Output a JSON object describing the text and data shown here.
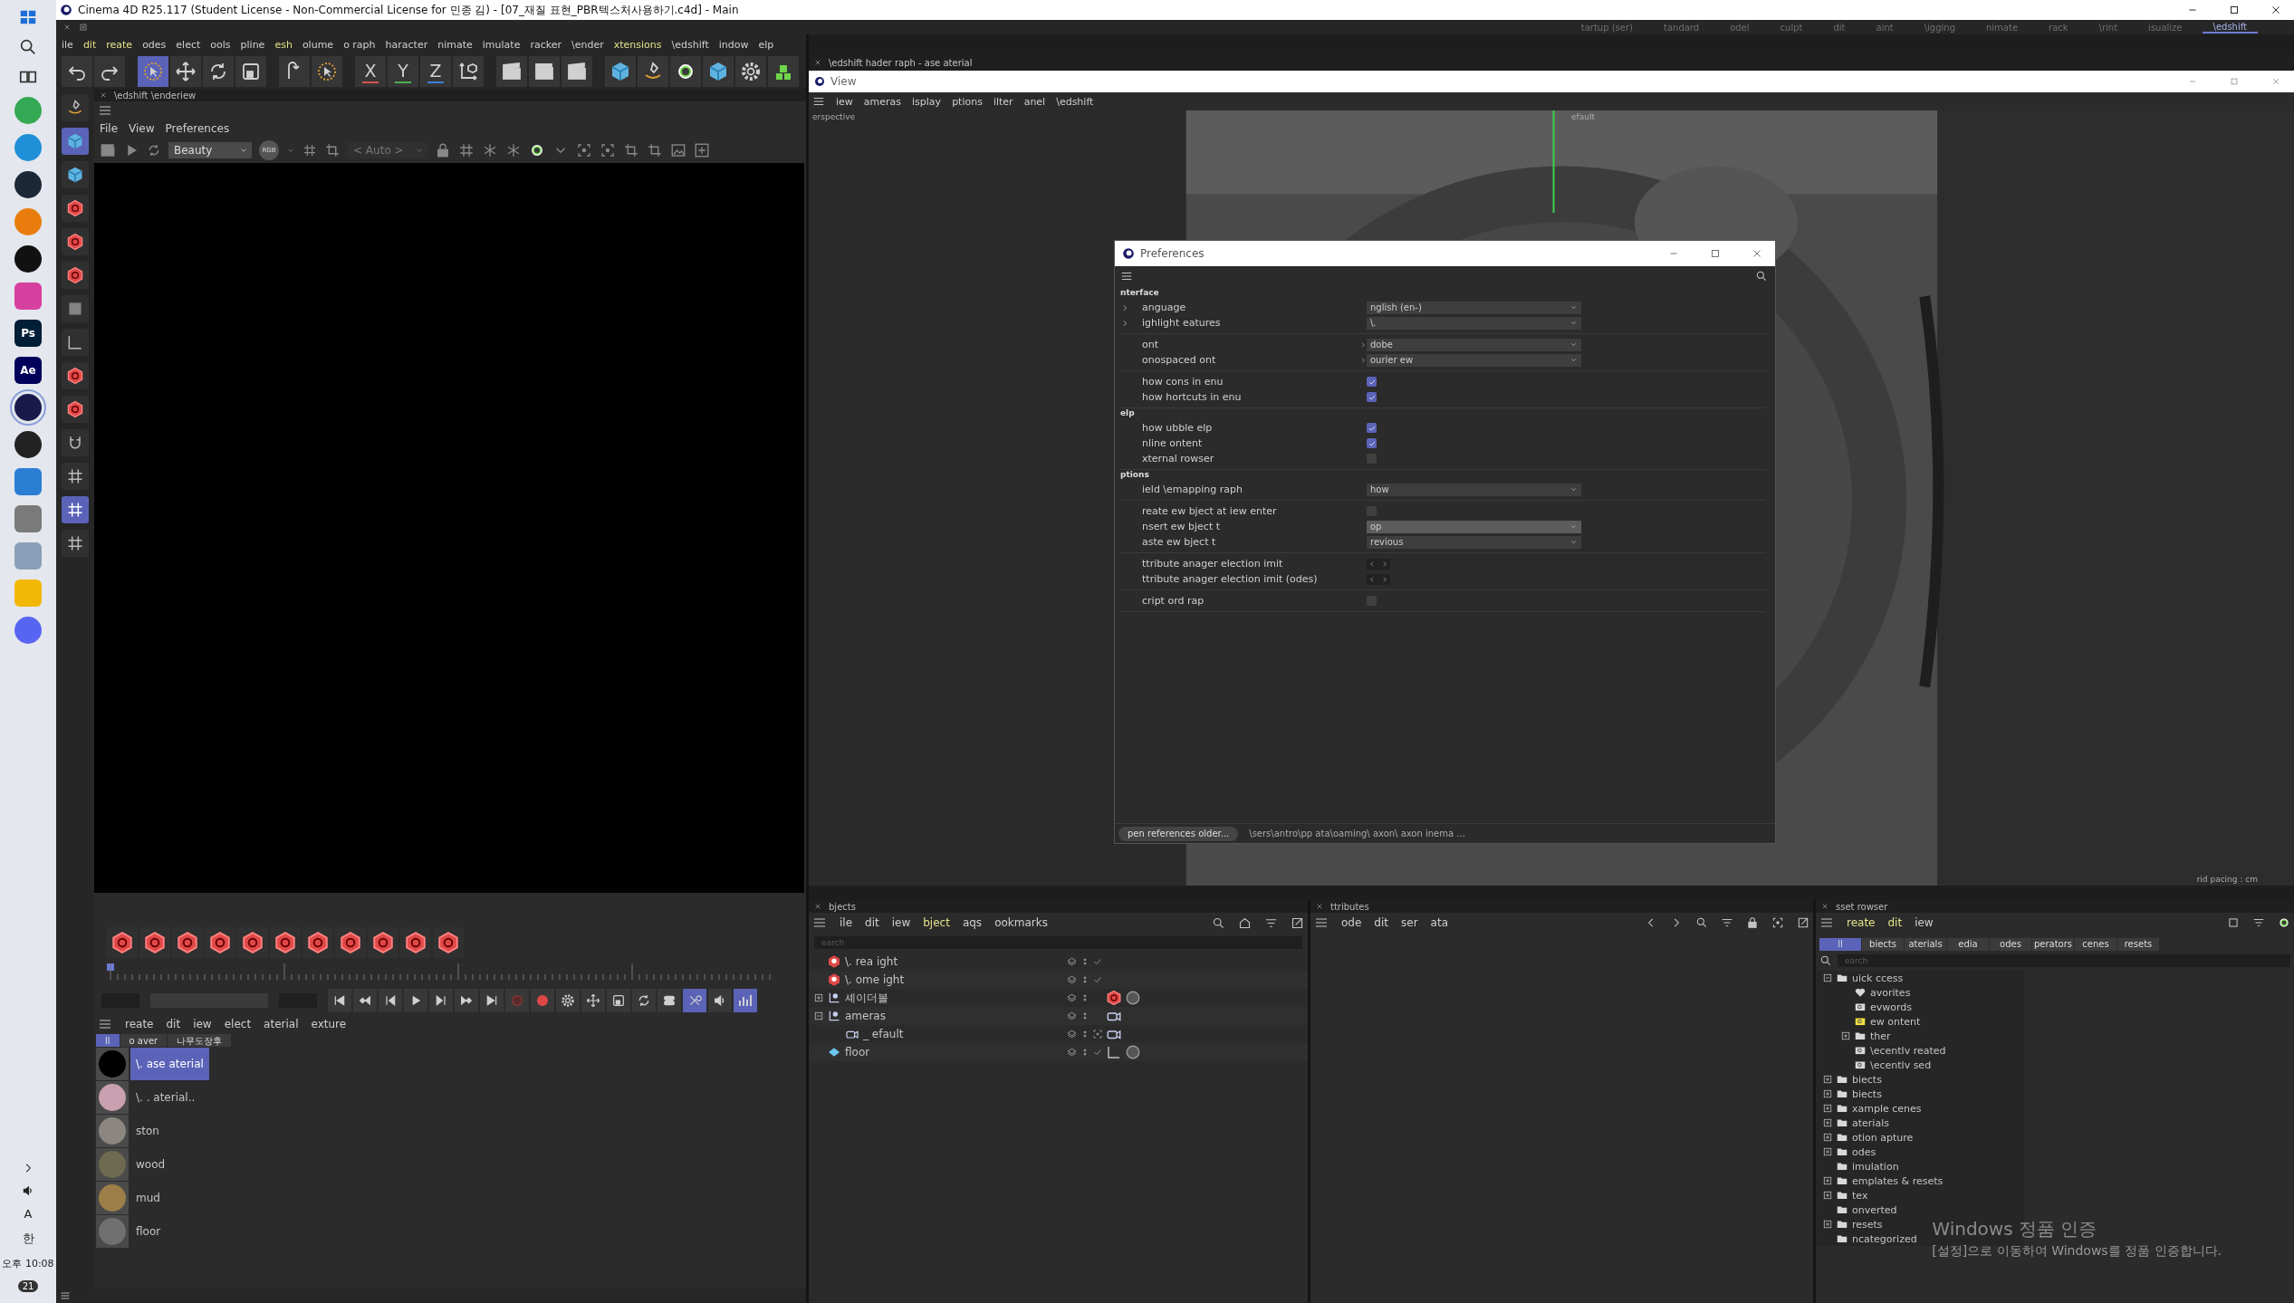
{
  "titlebar": {
    "title": "Cinema 4D R25.117 (Student License - Non-Commercial License for 민종 김) - [07_재질 표현_PBR텍스처사용하기.c4d] - Main"
  },
  "taskbar": {
    "apps": [
      {
        "kind": "circle",
        "color": "#34a853",
        "selected": false
      },
      {
        "kind": "circle",
        "color": "#1f8fd8",
        "selected": false
      },
      {
        "kind": "circle",
        "color": "#1b2838",
        "selected": false
      },
      {
        "kind": "circle",
        "color": "#e87d0d",
        "selected": false
      },
      {
        "kind": "circle",
        "color": "#111111",
        "selected": false
      },
      {
        "kind": "tile",
        "color": "#d6409f",
        "selected": false
      },
      {
        "kind": "tile",
        "color": "#001e36",
        "label": "Ps",
        "selected": false
      },
      {
        "kind": "tile",
        "color": "#00005b",
        "label": "Ae",
        "selected": false
      },
      {
        "kind": "circle",
        "color": "#1a1a4a",
        "selected": true
      },
      {
        "kind": "circle",
        "color": "#222222",
        "selected": false
      },
      {
        "kind": "tile",
        "color": "#2a7fd4",
        "selected": false
      },
      {
        "kind": "tile",
        "color": "#7a7a7a",
        "selected": false
      },
      {
        "kind": "tile",
        "color": "#8aa0b8",
        "selected": false
      },
      {
        "kind": "tile",
        "color": "#f2b705",
        "selected": false
      },
      {
        "kind": "circle",
        "color": "#5865f2",
        "selected": false
      }
    ],
    "input": [
      "A",
      "한"
    ],
    "clock": "오후 10:08",
    "badge": "21"
  },
  "layouts": [
    {
      "label": "tartup (ser)",
      "selected": false
    },
    {
      "label": "tandard",
      "selected": false
    },
    {
      "label": "odel",
      "selected": false
    },
    {
      "label": "culpt",
      "selected": false
    },
    {
      "label": "dit",
      "selected": false
    },
    {
      "label": "aint",
      "selected": false
    },
    {
      "label": "\\igging",
      "selected": false
    },
    {
      "label": "nimate",
      "selected": false
    },
    {
      "label": "rack",
      "selected": false
    },
    {
      "label": "\\rint",
      "selected": false
    },
    {
      "label": "isualize",
      "selected": false
    },
    {
      "label": "\\edshift",
      "selected": true
    }
  ],
  "menubar": [
    {
      "label": "ile",
      "highlight": false
    },
    {
      "label": "dit",
      "highlight": true
    },
    {
      "label": "reate",
      "highlight": true
    },
    {
      "label": "odes",
      "highlight": false
    },
    {
      "label": "elect",
      "highlight": false
    },
    {
      "label": "ools",
      "highlight": false
    },
    {
      "label": "pline",
      "highlight": false
    },
    {
      "label": "esh",
      "highlight": true
    },
    {
      "label": "olume",
      "highlight": false
    },
    {
      "label": "o raph",
      "highlight": false
    },
    {
      "label": "haracter",
      "highlight": false
    },
    {
      "label": "nimate",
      "highlight": false
    },
    {
      "label": "imulate",
      "highlight": false
    },
    {
      "label": "racker",
      "highlight": false
    },
    {
      "label": "\\ender",
      "highlight": false
    },
    {
      "label": "xtensions",
      "highlight": true
    },
    {
      "label": "\\edshift",
      "highlight": false
    },
    {
      "label": "indow",
      "highlight": false
    },
    {
      "label": "elp",
      "highlight": false
    }
  ],
  "toolbar": [
    {
      "kind": "icon",
      "selected": false
    },
    {
      "kind": "icon",
      "selected": false
    },
    {
      "kind": "gap"
    },
    {
      "kind": "icon",
      "selected": true
    },
    {
      "kind": "icon",
      "selected": false
    },
    {
      "kind": "icon",
      "selected": false
    },
    {
      "kind": "icon",
      "selected": false
    },
    {
      "kind": "gap"
    },
    {
      "kind": "icon",
      "selected": false
    },
    {
      "kind": "icon",
      "selected": false
    },
    {
      "kind": "gap"
    },
    {
      "kind": "axis",
      "label": "X",
      "color": "#d9534f"
    },
    {
      "kind": "axis",
      "label": "Y",
      "color": "#4caf50"
    },
    {
      "kind": "axis",
      "label": "Z",
      "color": "#3f7fd8"
    },
    {
      "kind": "icon",
      "selected": false
    },
    {
      "kind": "gap"
    },
    {
      "kind": "icon",
      "selected": false
    },
    {
      "kind": "icon",
      "selected": false
    },
    {
      "kind": "icon",
      "selected": false
    },
    {
      "kind": "gap"
    },
    {
      "kind": "icon",
      "selected": false
    },
    {
      "kind": "icon",
      "selected": false
    },
    {
      "kind": "icon",
      "selected": false
    },
    {
      "kind": "icon",
      "selected": false
    },
    {
      "kind": "icon",
      "selected": false
    },
    {
      "kind": "icon",
      "selected": false
    }
  ],
  "tools": [
    {
      "selected": false
    },
    {
      "selected": true
    },
    {
      "selected": false
    },
    {
      "selected": false
    },
    {
      "selected": false
    },
    {
      "selected": false
    },
    {
      "selected": false
    },
    {
      "selected": false
    },
    {
      "selected": false
    },
    {
      "selected": false
    },
    {
      "selected": false
    },
    {
      "selected": false
    },
    {
      "selected": true
    },
    {
      "selected": false
    }
  ],
  "renderview": {
    "tab": "\\edshift \\enderiew",
    "menu": [
      "File",
      "View",
      "Preferences"
    ],
    "aov": "Beauty",
    "channel": "RGB",
    "zoom": "< Auto >"
  },
  "playback": [
    {
      "selected": false
    },
    {
      "selected": false
    },
    {
      "selected": false
    },
    {
      "selected": false
    },
    {
      "selected": false
    },
    {
      "selected": false
    },
    {
      "selected": false
    },
    {
      "selected": false
    },
    {
      "selected": false
    },
    {
      "selected": false
    },
    {
      "selected": false
    },
    {
      "selected": false
    },
    {
      "selected": false
    },
    {
      "selected": false
    },
    {
      "selected": true
    },
    {
      "selected": false
    },
    {
      "selected": true
    }
  ],
  "materials": {
    "menu": [
      "reate",
      "dit",
      "iew",
      "elect",
      "aterial",
      "exture"
    ],
    "tabs": [
      {
        "label": "ll",
        "selected": true
      },
      {
        "label": "o  aver",
        "selected": false
      },
      {
        "label": "나무도장후",
        "selected": false
      }
    ],
    "items": [
      {
        "name": "\\. ase  aterial",
        "color": "#000000",
        "selected": true
      },
      {
        "name": "\\. . aterial..",
        "color": "#c8a0b0",
        "selected": false
      },
      {
        "name": "ston",
        "color": "#8c8680",
        "selected": false
      },
      {
        "name": "wood",
        "color": "#6e6a50",
        "selected": false
      },
      {
        "name": "mud",
        "color": "#9c7f48",
        "selected": false
      },
      {
        "name": "floor",
        "color": "#707070",
        "selected": false
      }
    ]
  },
  "viewtab": "\\edshift hader raph - ase aterial",
  "view": {
    "title": "View",
    "menu": [
      "iew",
      "ameras",
      "isplay",
      "ptions",
      "ilter",
      "anel",
      "\\edshift"
    ],
    "camera": "erspective",
    "label": "efault",
    "status": "rid pacing : cm"
  },
  "preferences": {
    "title": "Preferences",
    "sections": [
      {
        "header": "nterface",
        "groups": [
          [
            {
              "label": "anguage",
              "kind": "dropdown",
              "value": "nglish (en-)",
              "expanded": false,
              "highlight": false
            },
            {
              "label": "ighlight eatures",
              "kind": "dropdown",
              "value": "\\.",
              "expanded": false,
              "highlight": false
            }
          ],
          [
            {
              "label": "ont",
              "kind": "font",
              "value": "dobe",
              "expanded": false,
              "highlight": false
            },
            {
              "label": "onospaced ont",
              "kind": "font",
              "value": "ourier ew",
              "expanded": false,
              "highlight": false
            }
          ],
          [
            {
              "label": "how cons in enu",
              "kind": "checkbox",
              "checked": true
            },
            {
              "label": "how hortcuts in enu",
              "kind": "checkbox",
              "checked": true
            }
          ]
        ]
      },
      {
        "header": "elp",
        "groups": [
          [
            {
              "label": "how ubble elp",
              "kind": "checkbox",
              "checked": true
            },
            {
              "label": "nline ontent",
              "kind": "checkbox",
              "checked": true
            },
            {
              "label": "xternal rowser",
              "kind": "checkbox",
              "checked": false
            }
          ]
        ]
      },
      {
        "header": "ptions",
        "groups": [
          [
            {
              "label": "ield \\emapping raph",
              "kind": "dropdown",
              "value": "how",
              "highlight": false
            }
          ],
          [
            {
              "label": "reate ew bject at iew enter",
              "kind": "checkbox",
              "checked": false
            },
            {
              "label": "nsert ew bject t",
              "kind": "dropdown",
              "value": "op",
              "highlight": true
            },
            {
              "label": "aste ew bject t",
              "kind": "dropdown",
              "value": "revious",
              "highlight": false
            }
          ],
          [
            {
              "label": "ttribute anager election imit",
              "kind": "stepper"
            },
            {
              "label": "ttribute anager election imit (odes)",
              "kind": "stepper"
            }
          ],
          [
            {
              "label": "cript ord rap",
              "kind": "checkbox",
              "checked": false
            }
          ]
        ]
      }
    ],
    "open_button": "pen references older...",
    "path": "\\sers\\antro\\pp ata\\oaming\\ axon\\ axon inema ..."
  },
  "objects": {
    "tab": "bjects",
    "menu": [
      {
        "label": "ile",
        "highlight": false
      },
      {
        "label": "dit",
        "highlight": false
      },
      {
        "label": "iew",
        "highlight": false
      },
      {
        "label": "bject",
        "highlight": true
      },
      {
        "label": "aqs",
        "highlight": false
      },
      {
        "label": "ookmarks",
        "highlight": false
      }
    ],
    "placeholder": "earch",
    "rows": [
      {
        "name": "\\. rea ight",
        "kind": "light",
        "check": true
      },
      {
        "name": "\\. ome ight",
        "kind": "light",
        "check": true
      },
      {
        "name": "셰이더볼",
        "kind": "null",
        "expanded": false,
        "check": false,
        "tags": [
          {
            "kind": "redshift"
          },
          {
            "kind": "material"
          }
        ]
      },
      {
        "name": "ameras",
        "kind": "null",
        "expanded": true,
        "check": false,
        "tags": [
          {
            "kind": "camera"
          }
        ],
        "children": [
          {
            "name": "_ efault",
            "kind": "camera",
            "check": false,
            "target": true,
            "tags": [
              {
                "kind": "camera"
              }
            ]
          }
        ]
      },
      {
        "name": "floor",
        "kind": "plane",
        "check": true,
        "tags": [
          {
            "kind": "texture"
          },
          {
            "kind": "material"
          }
        ]
      }
    ]
  },
  "attributes": {
    "tab": "ttributes",
    "menu": [
      "ode",
      "dit",
      "ser",
      "ata"
    ]
  },
  "assets": {
    "tab": "sset rowser",
    "menu": [
      {
        "label": "reate",
        "highlight": true
      },
      {
        "label": "dit",
        "highlight": true
      },
      {
        "label": "iew",
        "highlight": false
      }
    ],
    "tabs": [
      {
        "label": "ll",
        "selected": true
      },
      {
        "label": "biects",
        "selected": false
      },
      {
        "label": "aterials",
        "selected": false
      },
      {
        "label": "edia",
        "selected": false
      },
      {
        "label": "odes",
        "selected": false
      },
      {
        "label": "perators",
        "selected": false
      },
      {
        "label": "cenes",
        "selected": false
      },
      {
        "label": "resets",
        "selected": false
      }
    ],
    "placeholder": "earch",
    "tree": [
      {
        "name": "uick ccess",
        "kind": "folder",
        "expanded": true,
        "children": [
          {
            "name": "avorites",
            "kind": "favorites"
          },
          {
            "name": "evwords",
            "kind": "smart"
          },
          {
            "name": "ew ontent",
            "kind": "new"
          },
          {
            "name": "ther",
            "kind": "folder",
            "expanded": false
          },
          {
            "name": "\\ecentlv reated",
            "kind": "smart"
          },
          {
            "name": "\\ecentlv sed",
            "kind": "smart"
          }
        ]
      },
      {
        "name": "biects",
        "kind": "folder",
        "expanded": false
      },
      {
        "name": "biects",
        "kind": "folder",
        "expanded": false
      },
      {
        "name": "xample cenes",
        "kind": "folder",
        "expanded": false
      },
      {
        "name": "aterials",
        "kind": "folder",
        "expanded": false
      },
      {
        "name": "otion apture",
        "kind": "folder",
        "expanded": false
      },
      {
        "name": "odes",
        "kind": "folder",
        "expanded": false
      },
      {
        "name": "imulation",
        "kind": "folder"
      },
      {
        "name": "emplates & resets",
        "kind": "folder",
        "expanded": false
      },
      {
        "name": "tex",
        "kind": "folder",
        "expanded": false
      },
      {
        "name": "onverted",
        "kind": "folder"
      },
      {
        "name": "resets",
        "kind": "folder",
        "expanded": false
      },
      {
        "name": "ncategorized",
        "kind": "folder"
      }
    ]
  },
  "activation": {
    "title": "Windows 정품 인증",
    "text": "[설정]으로 이동하여 Windows를 정품 인증합니다."
  }
}
